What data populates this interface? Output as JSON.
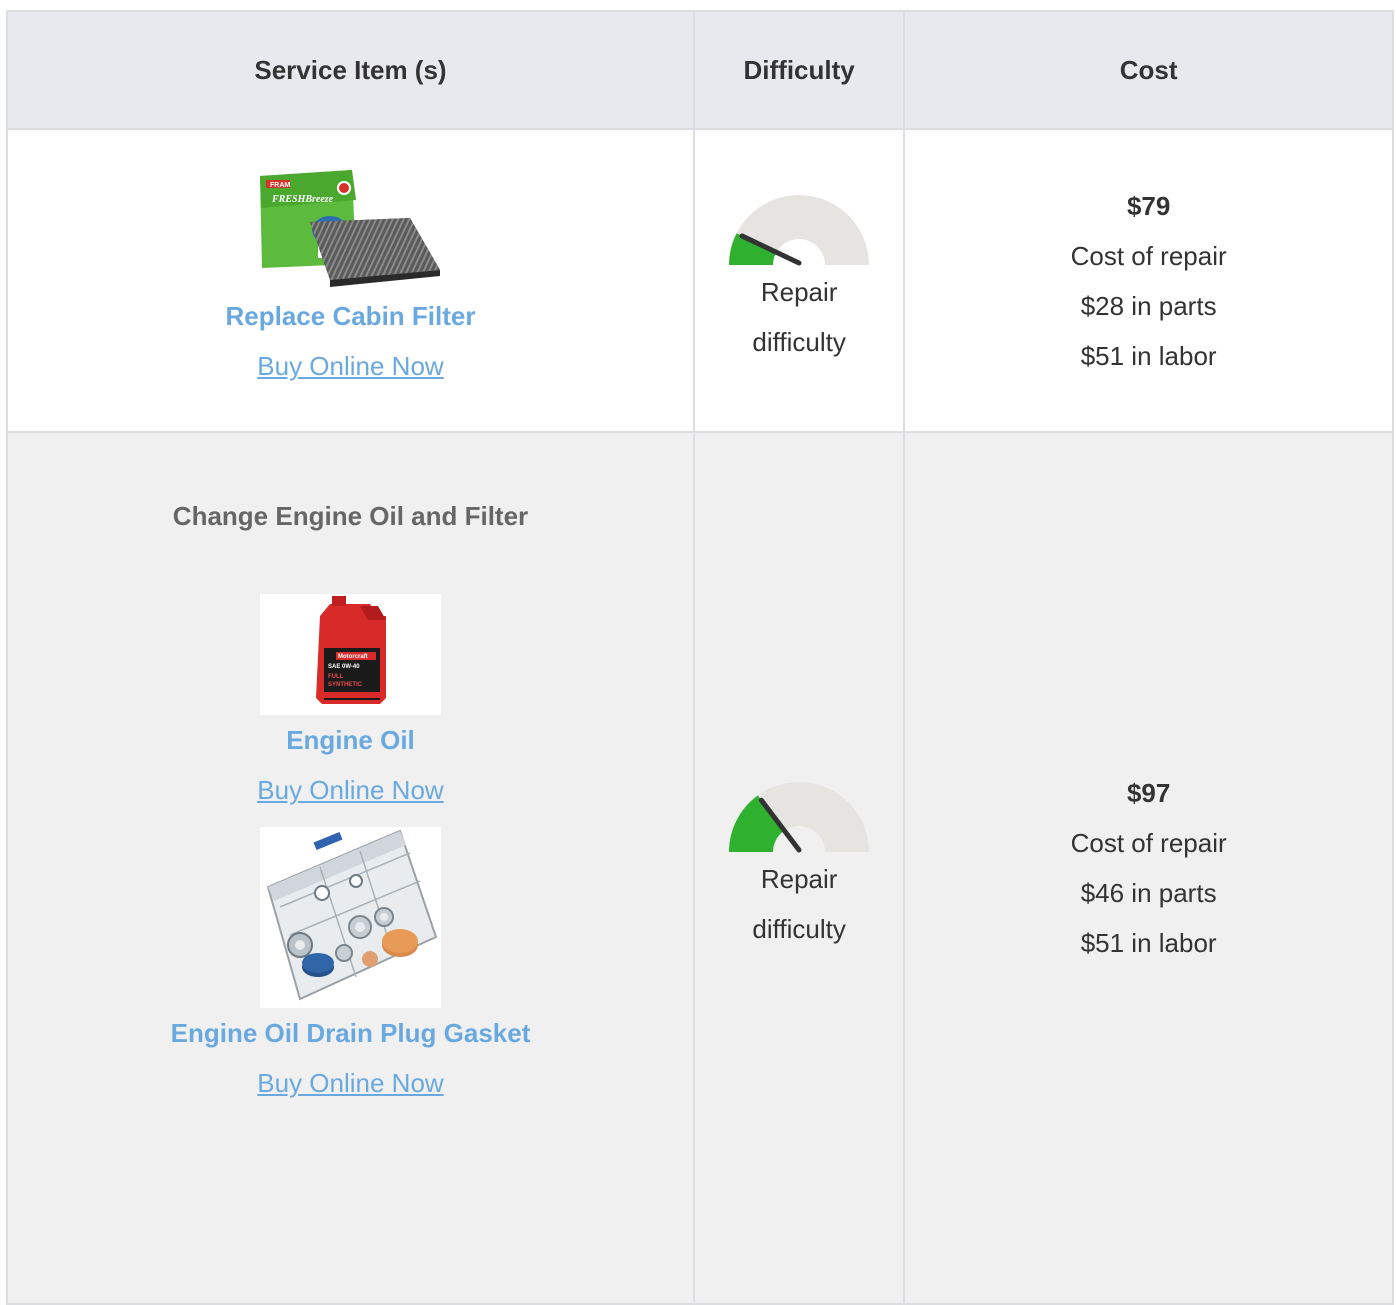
{
  "table": {
    "headers": {
      "service": "Service Item (s)",
      "difficulty": "Difficulty",
      "cost": "Cost"
    }
  },
  "rows": [
    {
      "item": {
        "title": "Replace Cabin Filter",
        "link": "Buy Online Now",
        "image_icon": "cabin-filter-product-image"
      },
      "difficulty": {
        "label_line1": "Repair",
        "label_line2": "difficulty",
        "level": 0.15
      },
      "cost": {
        "total": "$79",
        "label": "Cost of repair",
        "parts": "$28 in parts",
        "labor": "$51 in labor"
      }
    },
    {
      "group_title": "Change Engine Oil and Filter",
      "items": [
        {
          "title": "Engine Oil",
          "link": "Buy Online Now",
          "image_icon": "engine-oil-product-image"
        },
        {
          "title": "Engine Oil Drain Plug Gasket",
          "link": "Buy Online Now",
          "image_icon": "drain-plug-gasket-kit-image"
        }
      ],
      "difficulty": {
        "label_line1": "Repair",
        "label_line2": "difficulty",
        "level": 0.3
      },
      "cost": {
        "total": "$97",
        "label": "Cost of repair",
        "parts": "$46 in parts",
        "labor": "$51 in labor"
      }
    }
  ],
  "colors": {
    "header_bg": "#e8e9ef",
    "link": "#6aa9e0",
    "gauge_track": "#e6e4e1",
    "gauge_fill": "#2fb02f",
    "row_alt_bg": "#f0f0f0"
  }
}
